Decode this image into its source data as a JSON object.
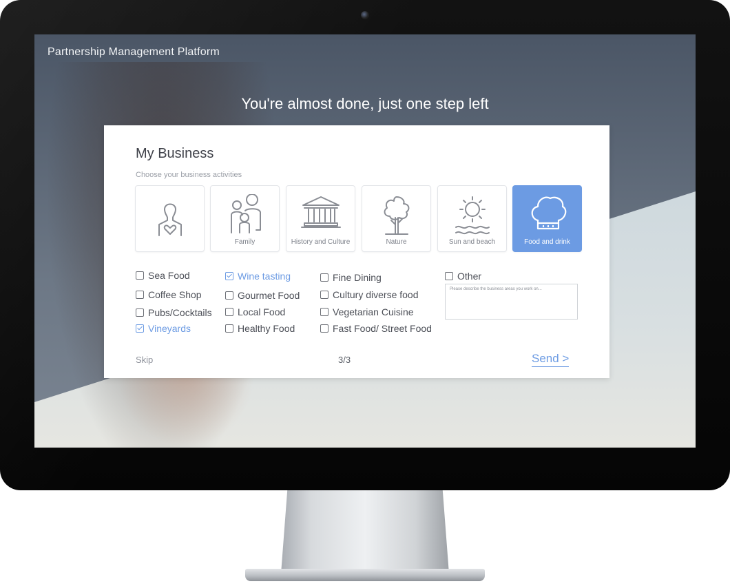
{
  "app": {
    "title": "Partnership Management Platform"
  },
  "headline": "You're almost done, just one step left",
  "card": {
    "title": "My Business",
    "subtitle": "Choose your business activities",
    "tiles": [
      {
        "label": "",
        "icon": "person-heart-icon",
        "selected": false
      },
      {
        "label": "Family",
        "icon": "family-icon",
        "selected": false
      },
      {
        "label": "History and Culture",
        "icon": "museum-icon",
        "selected": false
      },
      {
        "label": "Nature",
        "icon": "tree-icon",
        "selected": false
      },
      {
        "label": "Sun and beach",
        "icon": "sun-waves-icon",
        "selected": false
      },
      {
        "label": "Food and drink",
        "icon": "chef-hat-icon",
        "selected": true
      }
    ],
    "options": [
      {
        "label": "Sea Food",
        "checked": false
      },
      {
        "label": "Coffee Shop",
        "checked": false
      },
      {
        "label": "Pubs/Cocktails",
        "checked": false
      },
      {
        "label": "Vineyards",
        "checked": true
      },
      {
        "label": "Wine tasting",
        "checked": true
      },
      {
        "label": "Gourmet Food",
        "checked": false
      },
      {
        "label": "Local Food",
        "checked": false
      },
      {
        "label": "Healthy Food",
        "checked": false
      },
      {
        "label": "Fine Dining",
        "checked": false
      },
      {
        "label": "Cultury diverse food",
        "checked": false
      },
      {
        "label": "Vegetarian Cuisine",
        "checked": false
      },
      {
        "label": "Fast Food/ Street Food",
        "checked": false
      },
      {
        "label": "Other",
        "checked": false
      }
    ],
    "other_placeholder": "Please describe the business areas you work on...",
    "skip_label": "Skip",
    "pager": "3/3",
    "send_label": "Send >"
  },
  "colors": {
    "accent": "#6c9be3",
    "text": "#4c4f57",
    "muted": "#8d919a"
  }
}
